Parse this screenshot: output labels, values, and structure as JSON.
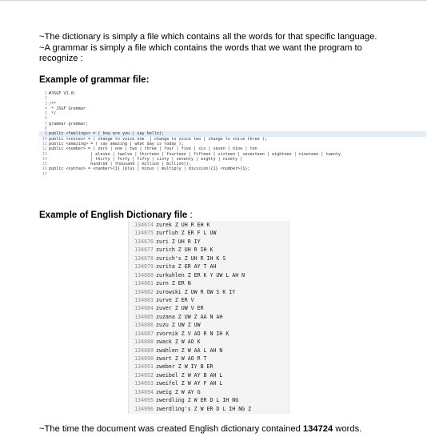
{
  "intro": {
    "line1": "~The dictionary is simply a file which contains all the words for that specific language.",
    "line2": "~A grammar is simply a file which contains the words that we want the program to",
    "line3": "recognize :"
  },
  "grammar_heading": "Example of grammar file:",
  "grammar_code": [
    {
      "n": "1",
      "t": "#JSGF V1.0;"
    },
    {
      "n": "2",
      "t": ""
    },
    {
      "n": "3",
      "t": "/**"
    },
    {
      "n": "4",
      "t": " * JSGF Grammar"
    },
    {
      "n": "5",
      "t": " */"
    },
    {
      "n": "6",
      "t": ""
    },
    {
      "n": "7",
      "t": "grammar grammar;"
    },
    {
      "n": "8",
      "t": ""
    },
    {
      "n": "9",
      "t": "public <feelings> = ( how are you | say hello);"
    },
    {
      "n": "10",
      "t": "public <voices> = ( change to voice one  | change to voice two | change to voice three );"
    },
    {
      "n": "11",
      "t": "public <amazing> = ( say amazing | what day is today );"
    },
    {
      "n": "12",
      "t": "public <number> = ( zero | one | two | three | four | five | six | seven | nine | ten"
    },
    {
      "n": "13",
      "t": "                 | eleven | twelve | thirteen | fourteen | fifteen | sixteen | seventeen | eighteen | nineteen | twenty"
    },
    {
      "n": "14",
      "t": "                 | thirty | forty | fifty | sixty | seventy | eighty | ninety |"
    },
    {
      "n": "15",
      "t": "                 hundred | thousand | million | billion));"
    },
    {
      "n": "16",
      "t": "public <syntax> = <number>{1} (plus | minus | multiply | division){1} <number>{1};"
    },
    {
      "n": "17",
      "t": ""
    }
  ],
  "dict_heading": "Example of English Dictionary file",
  "dict_heading_colon": ":",
  "dictionary": [
    {
      "i": "134674",
      "w": "zurek Z UH R EH K"
    },
    {
      "i": "134675",
      "w": "zurfluh Z ER F L UW"
    },
    {
      "i": "134676",
      "w": "zuri Z UH R IY"
    },
    {
      "i": "134677",
      "w": "zurich Z UH R IH K"
    },
    {
      "i": "134678",
      "w": "zurich's Z UH R IH K S"
    },
    {
      "i": "134679",
      "w": "zurita Z ER AY T AH"
    },
    {
      "i": "134680",
      "w": "zurkuhlen Z ER K Y UW L AH N"
    },
    {
      "i": "134681",
      "w": "zurn Z ER N"
    },
    {
      "i": "134682",
      "w": "zurowski Z UW R OW S K IY"
    },
    {
      "i": "134683",
      "w": "zurve Z ER V"
    },
    {
      "i": "134684",
      "w": "zuver Z UW V ER"
    },
    {
      "i": "134685",
      "w": "zuzana Z UW Z AA N AH"
    },
    {
      "i": "134686",
      "w": "zuzu Z UW Z UW"
    },
    {
      "i": "134687",
      "w": "zvornik Z V AO R N IH K"
    },
    {
      "i": "134688",
      "w": "zwack Z W AO K"
    },
    {
      "i": "134689",
      "w": "zwahlen Z W AA L AH N"
    },
    {
      "i": "134690",
      "w": "zwart Z W AO R T"
    },
    {
      "i": "134691",
      "w": "zweber Z W IY B ER"
    },
    {
      "i": "134692",
      "w": "zweibel Z W AY B AH L"
    },
    {
      "i": "134693",
      "w": "zweifel Z W AY F AH L"
    },
    {
      "i": "134694",
      "w": "zweig Z W AY G"
    },
    {
      "i": "134695",
      "w": "zwerdling Z W ER D L IH NG"
    },
    {
      "i": "134696",
      "w": "zwerdling's Z W ER D L IH NG Z"
    }
  ],
  "footer": {
    "before": "~The time the document was created English dictionary contained ",
    "count": "134724",
    "after": " words."
  }
}
